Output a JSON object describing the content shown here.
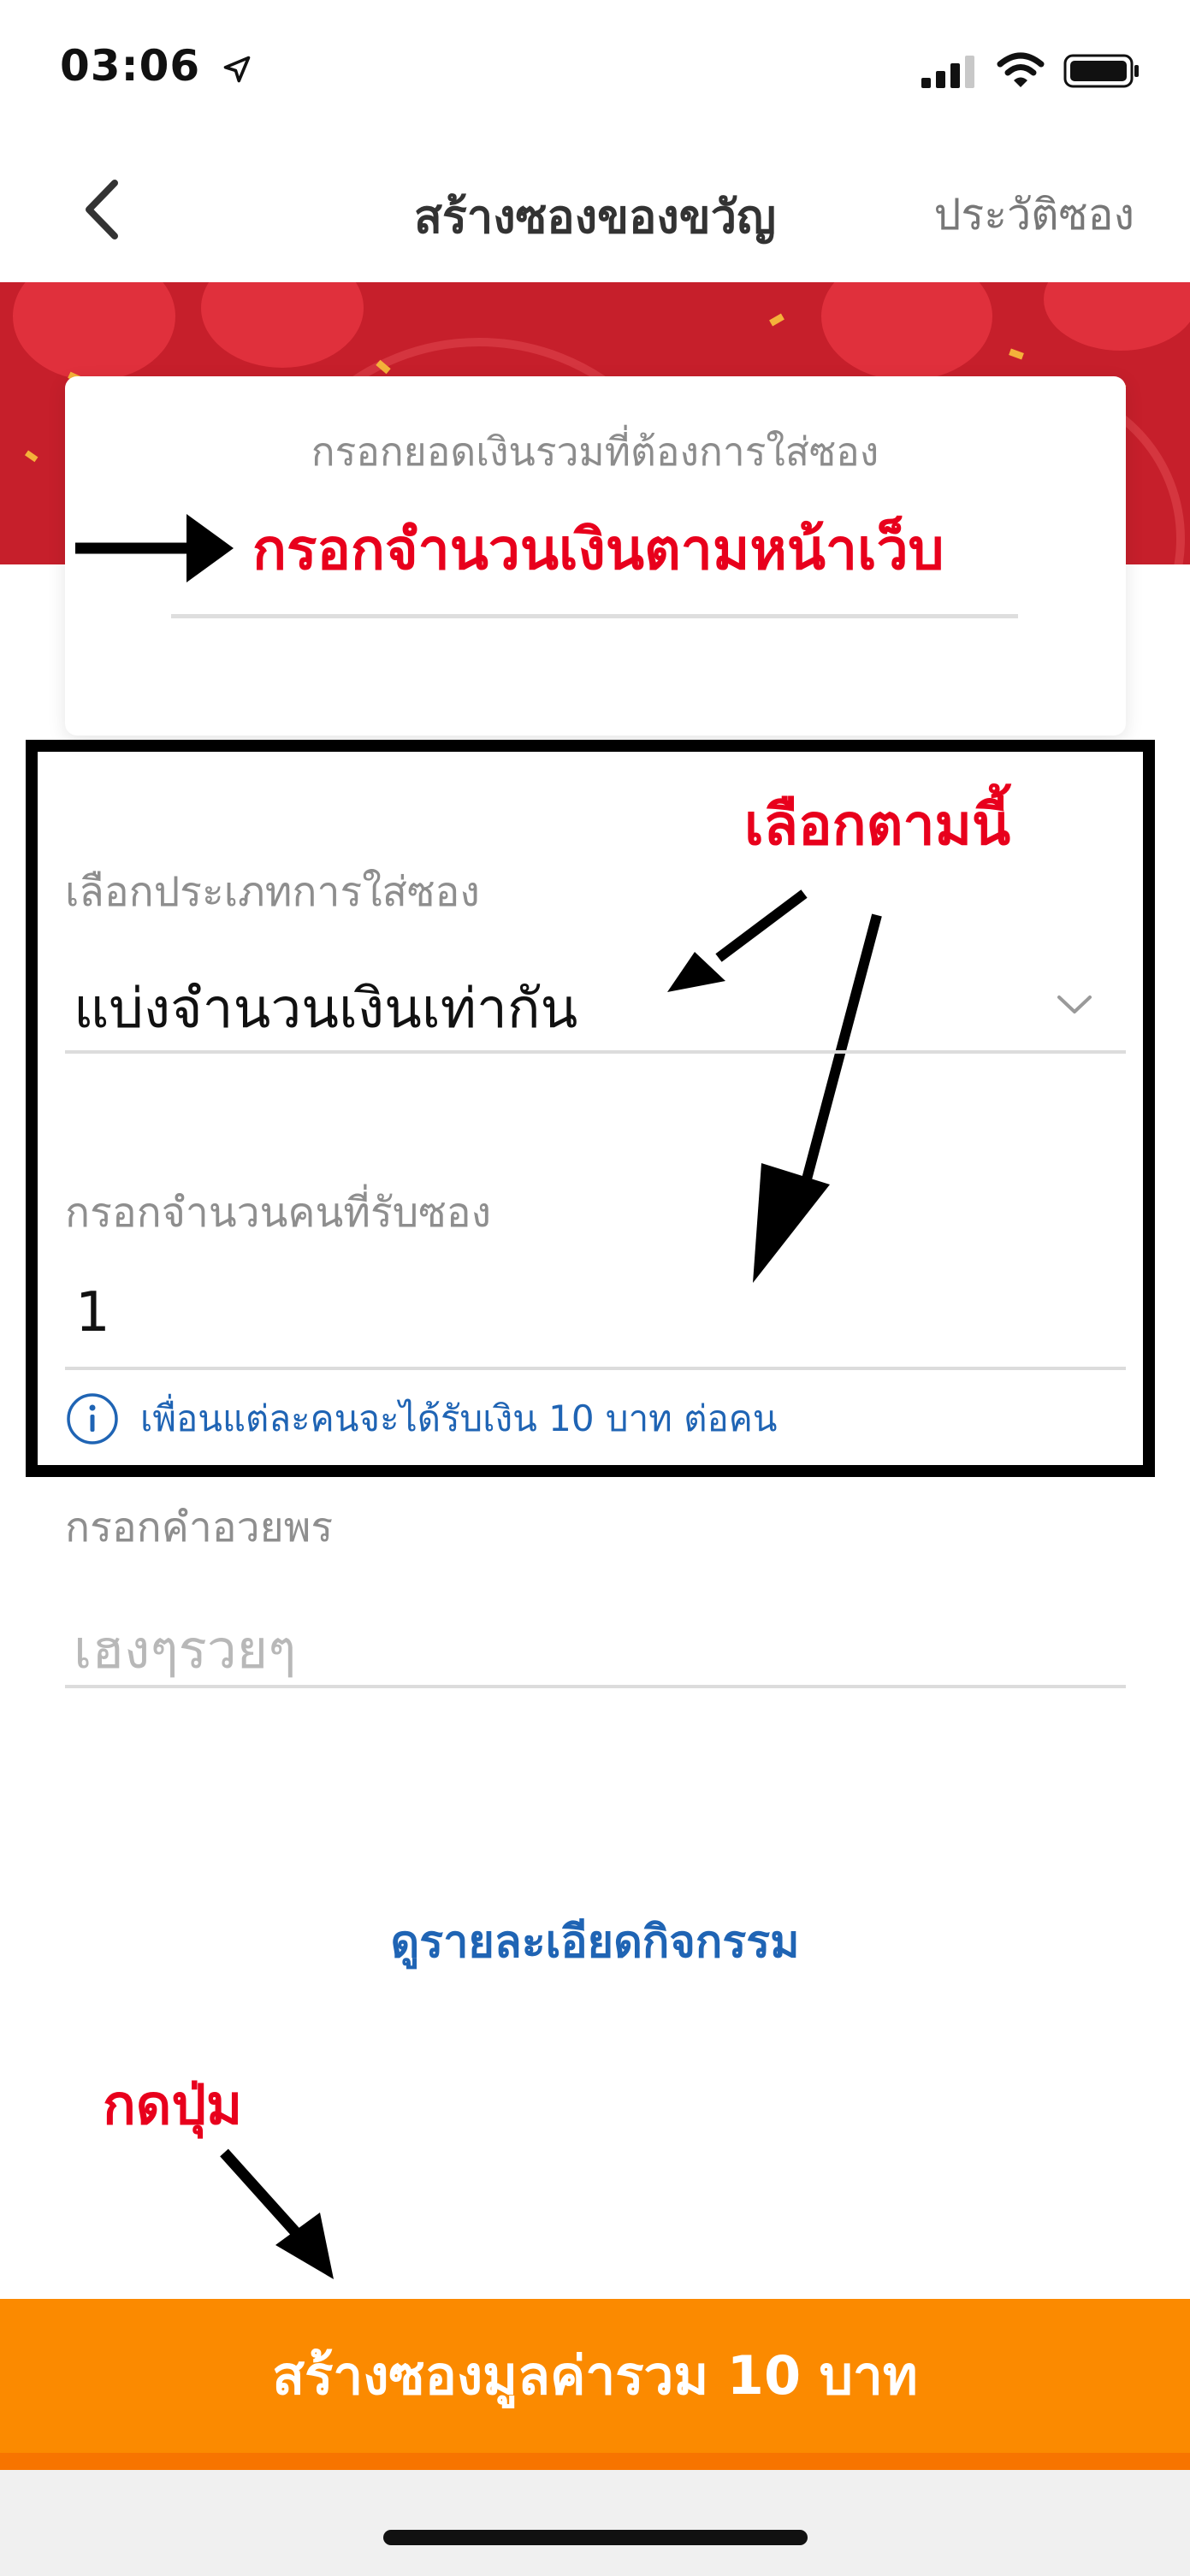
{
  "status_bar": {
    "time": "03:06"
  },
  "nav": {
    "title": "สร้างซองของขวัญ",
    "history_label": "ประวัติซอง"
  },
  "amount_card": {
    "label": "กรอกยอดเงินรวมที่ต้องการใส่ซอง"
  },
  "form": {
    "type_label": "เลือกประเภทการใส่ซอง",
    "type_value": "แบ่งจำนวนเงินเท่ากัน",
    "count_label": "กรอกจำนวนคนที่รับซอง",
    "count_value": "1",
    "info_text": "เพื่อนแต่ละคนจะได้รับเงิน 10 บาท ต่อคน",
    "wish_label": "กรอกคำอวยพร",
    "wish_placeholder": "เฮงๆรวยๆ"
  },
  "details_link": "ดูรายละเอียดกิจกรรม",
  "create_button": "สร้างซองมูลค่ารวม 10 บาท",
  "annotations": {
    "enter_amount": "กรอกจำนวนเงินตามหน้าเว็บ",
    "select_as_shown": "เลือกตามนี้",
    "press_button": "กดปุ่ม"
  },
  "colors": {
    "banner_red": "#c61f2b",
    "button_orange": "#fb8a00",
    "link_blue": "#1f64b4",
    "annotation_red": "#e8001c"
  },
  "icons": {
    "back": "chevron-left-icon",
    "location": "location-arrow-icon",
    "signal": "signal-icon",
    "wifi": "wifi-icon",
    "battery": "battery-icon",
    "dropdown": "chevron-down-icon",
    "info": "info-icon"
  }
}
